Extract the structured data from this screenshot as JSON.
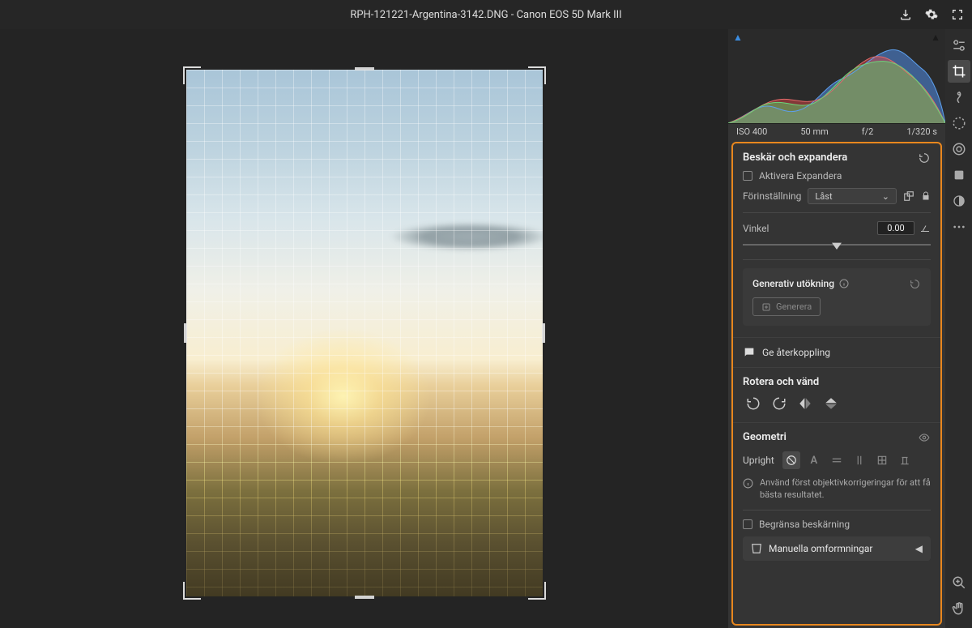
{
  "title": "RPH-121221-Argentina-3142.DNG  -  Canon EOS 5D Mark III",
  "histogram": {
    "iso": "ISO 400",
    "focal": "50 mm",
    "aperture": "f/2",
    "shutter": "1/320 s"
  },
  "crop": {
    "title": "Beskär och expandera",
    "activate_expand": "Aktivera Expandera",
    "preset_label": "Förinställning",
    "preset_value": "Låst",
    "angle_label": "Vinkel",
    "angle_value": "0.00"
  },
  "gen": {
    "title": "Generativ utökning",
    "generate": "Generera"
  },
  "feedback": "Ge återkoppling",
  "rotate": {
    "title": "Rotera och vänd"
  },
  "geometry": {
    "title": "Geometri",
    "upright": "Upright",
    "hint": "Använd först objektivkorrigeringar för att få bästa resultatet.",
    "constrain": "Begränsa beskärning",
    "manual": "Manuella omformningar"
  }
}
